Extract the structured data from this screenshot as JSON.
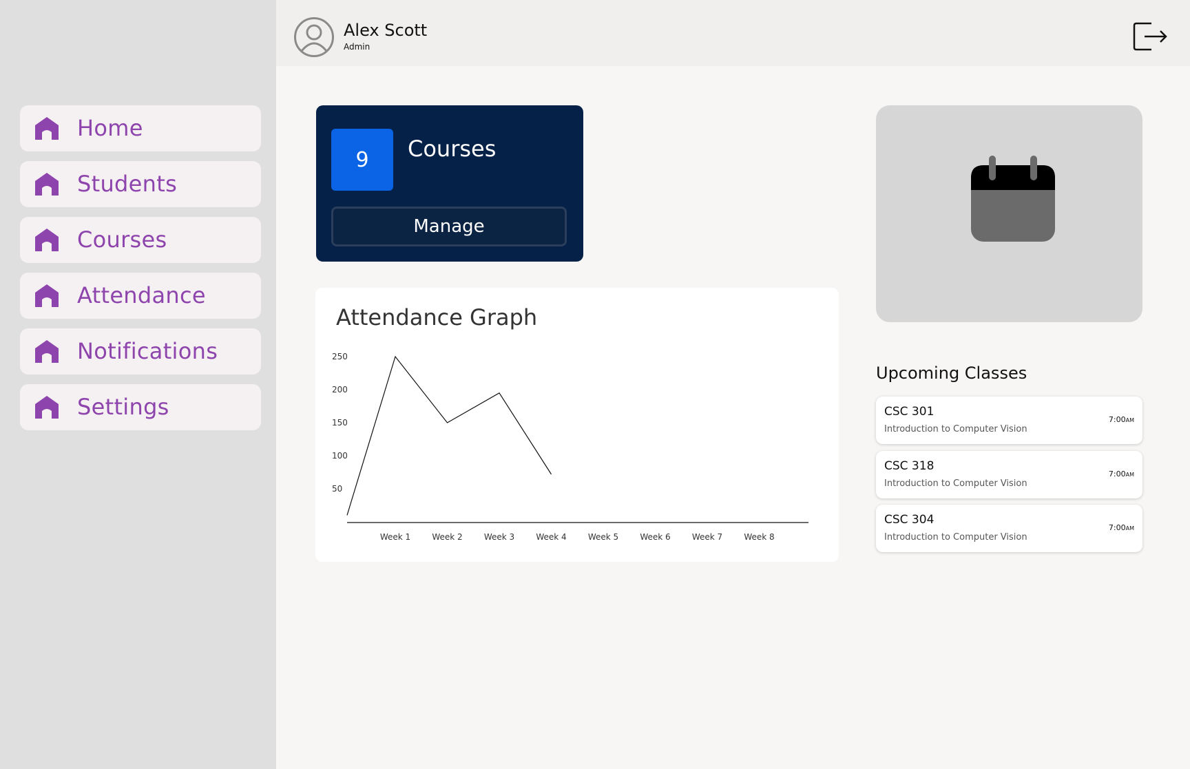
{
  "user": {
    "name": "Alex Scott",
    "role": "Admin"
  },
  "nav": [
    {
      "label": "Home"
    },
    {
      "label": "Students"
    },
    {
      "label": "Courses"
    },
    {
      "label": "Attendance"
    },
    {
      "label": "Notifications"
    },
    {
      "label": "Settings"
    }
  ],
  "courses_card": {
    "count": "9",
    "title": "Courses",
    "button": "Manage"
  },
  "graph": {
    "title": "Attendance Graph"
  },
  "chart_data": {
    "type": "line",
    "categories": [
      "Week 1",
      "Week 2",
      "Week 3",
      "Week 4",
      "Week 5",
      "Week 6",
      "Week 7",
      "Week 8"
    ],
    "start_value": 10,
    "values": [
      250,
      150,
      195,
      72,
      null,
      null,
      null,
      null
    ],
    "y_ticks": [
      50,
      100,
      150,
      200,
      250
    ],
    "ylim": [
      0,
      250
    ],
    "grid": false
  },
  "upcoming": {
    "title": "Upcoming Classes",
    "classes": [
      {
        "code": "CSC 301",
        "desc": "Introduction to Computer Vision",
        "time": "7:00",
        "ampm": "AM"
      },
      {
        "code": "CSC 318",
        "desc": "Introduction to Computer Vision",
        "time": "7:00",
        "ampm": "AM"
      },
      {
        "code": "CSC 304",
        "desc": "Introduction to Computer Vision",
        "time": "7:00",
        "ampm": "AM"
      }
    ]
  },
  "colors": {
    "nav_accent": "#8e44ad",
    "card_bg": "#062147",
    "count_bg": "#0b63e5"
  },
  "icons": {
    "nav": "home-icon",
    "avatar": "user-avatar-icon",
    "logout": "logout-icon",
    "calendar": "calendar-icon"
  }
}
